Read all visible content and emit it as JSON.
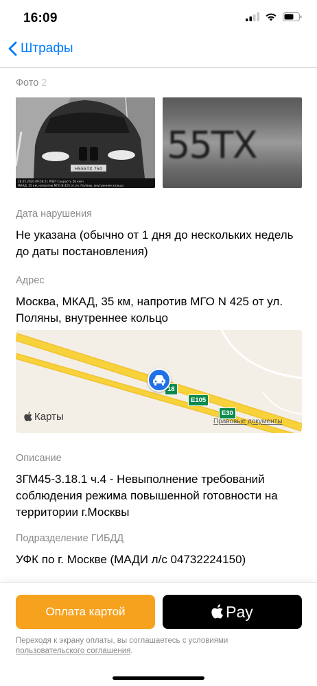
{
  "status_bar": {
    "time": "16:09"
  },
  "nav": {
    "back_label": "Штрафы"
  },
  "photos": {
    "label": "Фото",
    "count": "2",
    "car_caption_line1": "28.05.2020 09:58:21 РОЕТ Скорость 56 км/ч",
    "car_caption_line2": "МКАД, 35 км, напротив МГО N 425 от ул. Поляны, внутреннее кольцо",
    "car_plate": "Н555ТХ 750",
    "plate_closeup": "55ТХ"
  },
  "violation_date": {
    "label": "Дата нарушения",
    "value": "Не указана (обычно от 1 дня до нескольких недель до даты постановления)"
  },
  "address": {
    "label": "Адрес",
    "value": "Москва, МКАД, 35 км, напротив МГО N 425 от ул. Поляны, внутреннее кольцо"
  },
  "map": {
    "brand": "Карты",
    "legal": "Правовые документы",
    "badges": [
      "18",
      "E105",
      "E30"
    ],
    "road_color": "#f7d23a"
  },
  "description": {
    "label": "Описание",
    "value": "3ГМ45-3.18.1 ч.4 - Невыполнение требований соблюдения режима повышенной готовности на территории г.Москвы"
  },
  "department": {
    "label": "Подразделение ГИБДД",
    "value": "УФК по г. Москве (МАДИ л/с 04732224150)"
  },
  "payment": {
    "card_button": "Оплата картой",
    "apple_pay_label": "Pay",
    "disclaimer_text": "Переходя к экрану оплаты, вы соглашаетесь с условиями",
    "disclaimer_link": "пользовательского соглашения",
    "disclaimer_end": "."
  },
  "colors": {
    "accent": "#007aff",
    "pay_button": "#f6a21e"
  }
}
